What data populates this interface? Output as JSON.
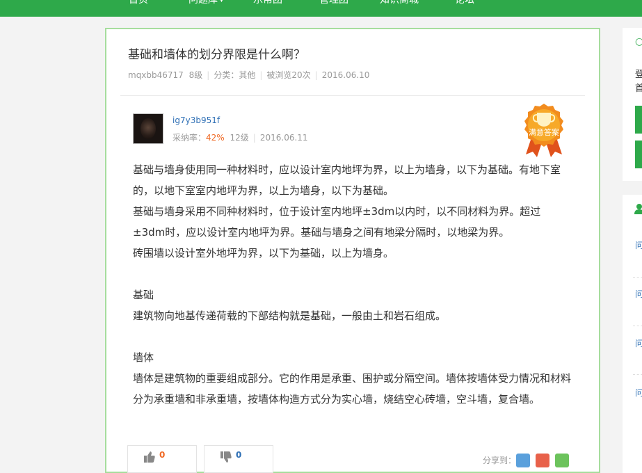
{
  "nav": {
    "items": [
      {
        "label": "首页"
      },
      {
        "label": "问题库",
        "caret": "▼"
      },
      {
        "label": "乐帮团"
      },
      {
        "label": "管理团"
      },
      {
        "label": "知识商城"
      },
      {
        "label": "论坛"
      }
    ]
  },
  "question": {
    "title": "基础和墙体的划分界限是什么啊？",
    "user": "mqxbb46717",
    "level": "8级",
    "category": "分类：其他",
    "views": "被浏览20次",
    "date": "2016.06.10"
  },
  "answer": {
    "user": "ig7y3b951f",
    "accept_label": "采纳率：",
    "accept_rate": "42%",
    "level": "12级",
    "date": "2016.06.11",
    "badge": "满意答案",
    "paragraphs": [
      "基础与墙身使用同一种材料时，应以设计室内地坪为界，以上为墙身，以下为基础。有地下室的，以地下室室内地坪为界，以上为墙身，以下为基础。",
      "基础与墙身采用不同种材料时，位于设计室内地坪±3dm以内时，以不同材料为界。超过±3dm时，应以设计室内地坪为界。基础与墙身之间有地梁分隔时，以地梁为界。",
      "砖围墙以设计室外地坪为界，以下为基础，以上为墙身。",
      "",
      "基础",
      "建筑物向地基传递荷载的下部结构就是基础，一般由土和岩石组成。",
      "",
      "墙体",
      "墙体是建筑物的重要组成部分。它的作用是承重、围护或分隔空间。墙体按墙体受力情况和材料分为承重墙和非承重墙，按墙体构造方式分为实心墙，烧结空心砖墙，空斗墙，复合墙。"
    ],
    "upvotes": "0",
    "downvotes": "0",
    "share_label": "分享到："
  },
  "sidebar": {
    "login_text_1": "登",
    "login_text_2": "首",
    "links": [
      "问",
      "问",
      "问",
      "问"
    ]
  },
  "colors": {
    "brand_green": "#2ea94a",
    "accept_orange": "#f06a25",
    "link_blue": "#2e6fb5"
  },
  "icons": [
    "thumbs-up-icon",
    "thumbs-down-icon",
    "weibo-icon",
    "qzone-icon",
    "wechat-icon",
    "trophy-badge-icon",
    "user-icon"
  ]
}
